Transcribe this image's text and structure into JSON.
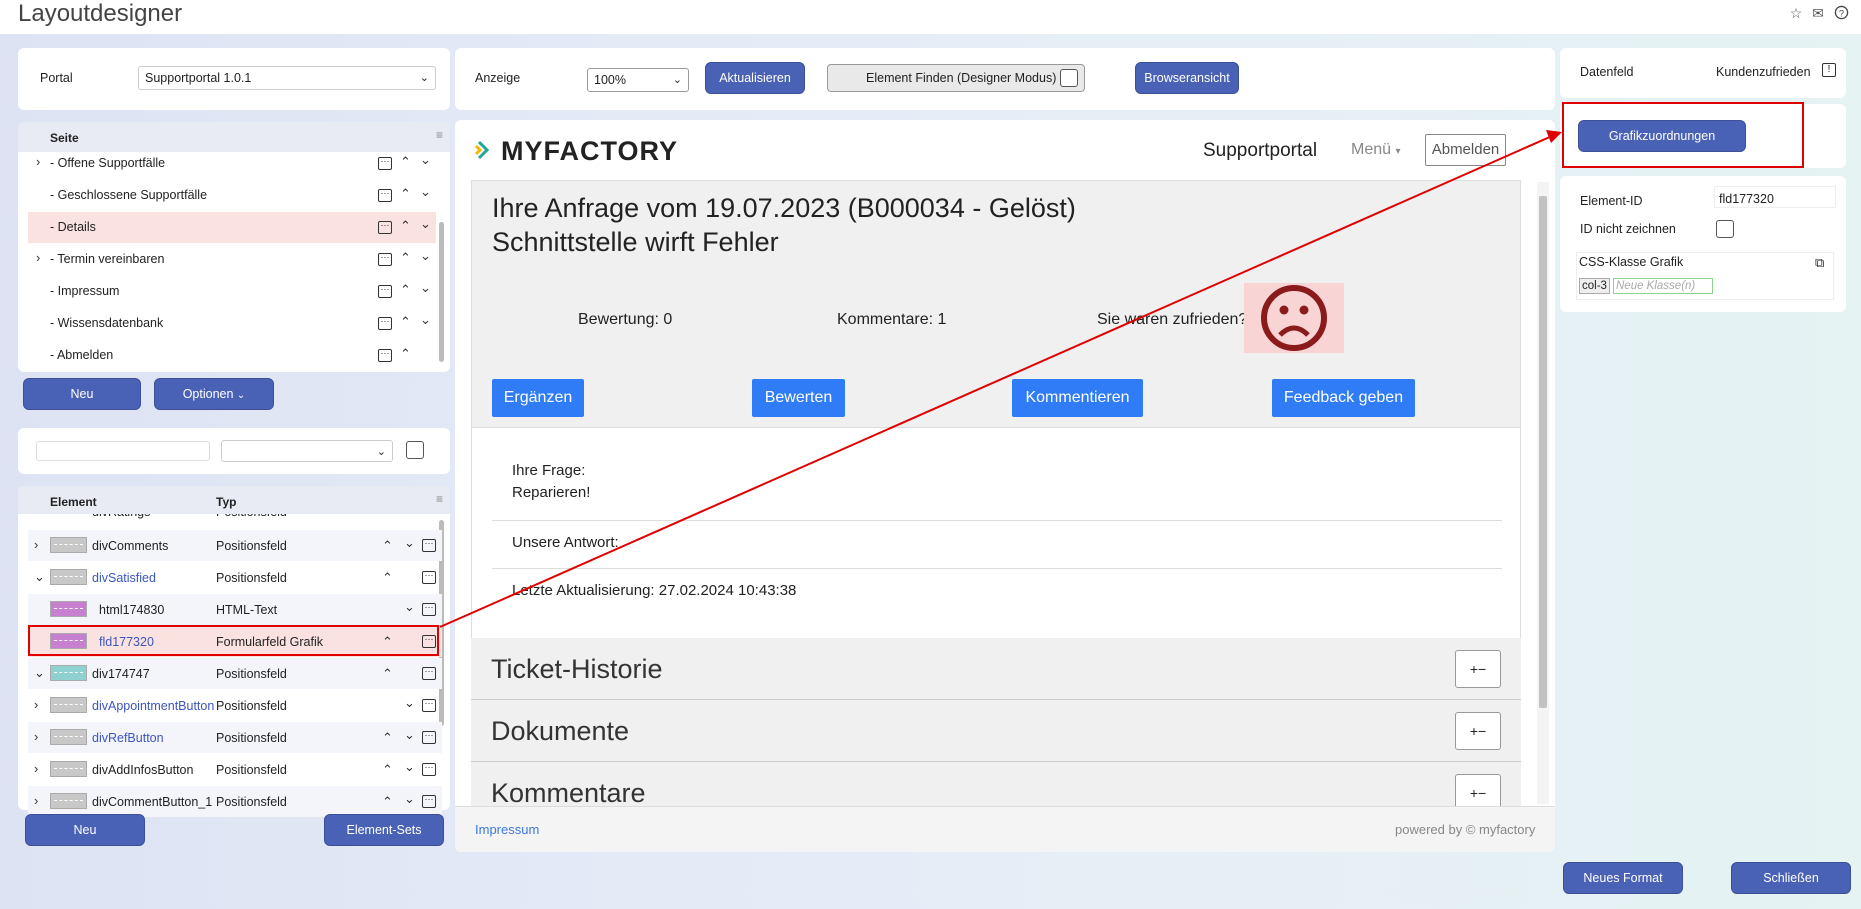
{
  "app": {
    "title": "Layoutdesigner"
  },
  "toolbar": {
    "portal_label": "Portal",
    "portal_value": "Supportportal 1.0.1",
    "anzeige_label": "Anzeige",
    "anzeige_value": "100%",
    "aktualisieren": "Aktualisieren",
    "element_finden": "Element Finden (Designer Modus)",
    "browseransicht": "Browseransicht"
  },
  "pages": {
    "header": "Seite",
    "items": [
      {
        "label": "- Offene Supportfälle",
        "expandable": true
      },
      {
        "label": "- Geschlossene Supportfälle",
        "expandable": false
      },
      {
        "label": "- Details",
        "expandable": false,
        "selected": true
      },
      {
        "label": "- Termin vereinbaren",
        "expandable": true
      },
      {
        "label": "- Impressum",
        "expandable": false
      },
      {
        "label": "- Wissensdatenbank",
        "expandable": false
      },
      {
        "label": "- Abmelden",
        "expandable": false
      }
    ],
    "neu": "Neu",
    "optionen": "Optionen"
  },
  "elements": {
    "col_element": "Element",
    "col_typ": "Typ",
    "partial_row": {
      "name": "divRatings",
      "type": "Positionsfeld"
    },
    "rows": [
      {
        "name": "divComments",
        "type": "Positionsfeld"
      },
      {
        "name": "divSatisfied",
        "type": "Positionsfeld"
      },
      {
        "name": "html174830",
        "type": "HTML-Text"
      },
      {
        "name": "fld177320",
        "type": "Formularfeld Grafik"
      },
      {
        "name": "div174747",
        "type": "Positionsfeld"
      },
      {
        "name": "divAppointmentButton",
        "type": "Positionsfeld"
      },
      {
        "name": "divRefButton",
        "type": "Positionsfeld"
      },
      {
        "name": "divAddInfosButton",
        "type": "Positionsfeld"
      },
      {
        "name": "divCommentButton_1",
        "type": "Positionsfeld"
      }
    ],
    "neu": "Neu",
    "element_sets": "Element-Sets"
  },
  "preview": {
    "logo_text": "MYFACTORY",
    "portal_name": "Supportportal",
    "menu": "Menü",
    "abmelden": "Abmelden",
    "request_title": "Ihre Anfrage vom 19.07.2023 (B000034 - Gelöst)",
    "request_subtitle": "Schnittstelle wirft Fehler",
    "bewertung": "Bewertung: 0",
    "kommentare": "Kommentare: 1",
    "zufrieden": "Sie waren zufrieden?",
    "buttons": [
      "Ergänzen",
      "Bewerten",
      "Kommentieren",
      "Feedback geben"
    ],
    "ihre_frage": "Ihre Frage:",
    "frage_text": "Reparieren!",
    "unsere_antwort": "Unsere Antwort:",
    "letzte_aktualisierung": "Letzte Aktualisierung: 27.02.2024 10:43:38",
    "sections": [
      "Ticket-Historie",
      "Dokumente",
      "Kommentare"
    ],
    "footer_link": "Impressum",
    "footer_powered": "powered by © myfactory"
  },
  "properties": {
    "datenfeld_label": "Datenfeld",
    "datenfeld_value": "Kundenzufrieden",
    "grafikzuordnungen": "Grafikzuordnungen",
    "element_id_label": "Element-ID",
    "element_id_value": "fld177320",
    "id_nicht_zeichnen": "ID nicht zeichnen",
    "css_klasse_label": "CSS-Klasse Grafik",
    "css_tag": "col-3",
    "css_placeholder": "Neue Klasse(n)"
  },
  "footer": {
    "neues_format": "Neues Format",
    "schliessen": "Schließen"
  },
  "colors": {
    "accent": "#4a62b5",
    "portal_button": "#2f7cf6",
    "highlight_red": "#e00000",
    "selected_row": "#f9e2e0"
  }
}
